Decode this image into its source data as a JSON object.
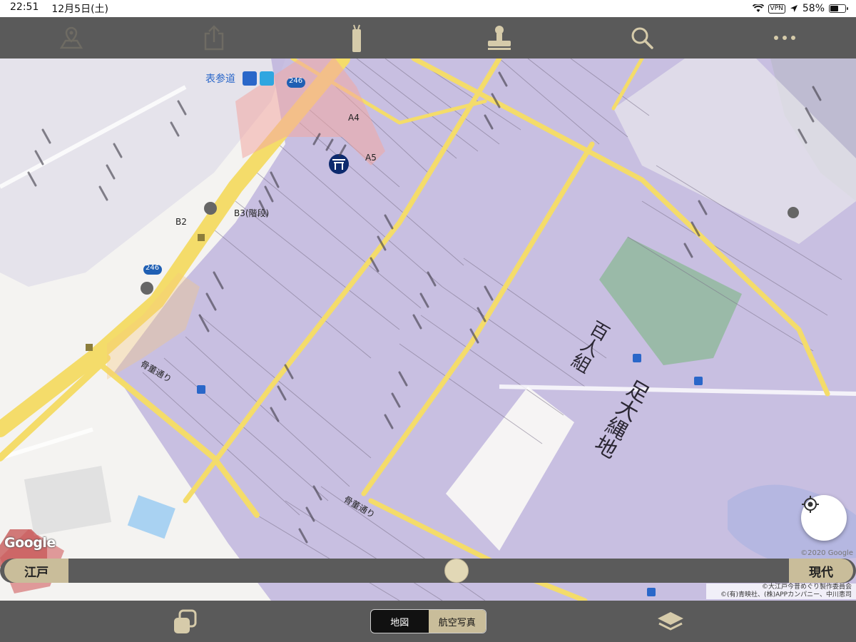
{
  "status_bar": {
    "time": "22:51",
    "date": "12月5日(土)",
    "vpn": "VPN",
    "battery": "58%",
    "battery_level": 0.58
  },
  "toolbar": {
    "items": [
      {
        "icon": "map-pin-icon"
      },
      {
        "icon": "share-icon"
      },
      {
        "icon": "stick-icon"
      },
      {
        "icon": "stamp-icon"
      },
      {
        "icon": "search-icon"
      },
      {
        "icon": "more-icon"
      }
    ]
  },
  "map": {
    "station_name": "表参道",
    "route_number_top": "246",
    "route_number_left": "246",
    "exit_a4": "A4",
    "exit_a5": "A5",
    "exit_b2": "B2",
    "exit_b3": "B3(階段)",
    "street_label_1": "骨董通り",
    "street_label_2": "骨董通り",
    "kanji_main": "足大縄地",
    "kanji_sub": "百人組",
    "google": "Google",
    "copyright": "©2020 Google",
    "credit_line1": "©大江戸今昔めぐり製作委員会",
    "credit_line2": "©(有)青映社、(株)APPカンパニー、中川恵司"
  },
  "time_slider": {
    "left_label": "江戸",
    "right_label": "現代",
    "position": 0.54
  },
  "bottom_bar": {
    "segments": [
      "地図",
      "航空写真"
    ],
    "active_segment": 1
  },
  "colors": {
    "toolbar_bg": "#5a5a5a",
    "accent_tan": "#c9bd9a",
    "edo_overlay": "#b9aedb",
    "road_yellow": "#f4dc6a",
    "station_blue": "#2a67c9"
  }
}
